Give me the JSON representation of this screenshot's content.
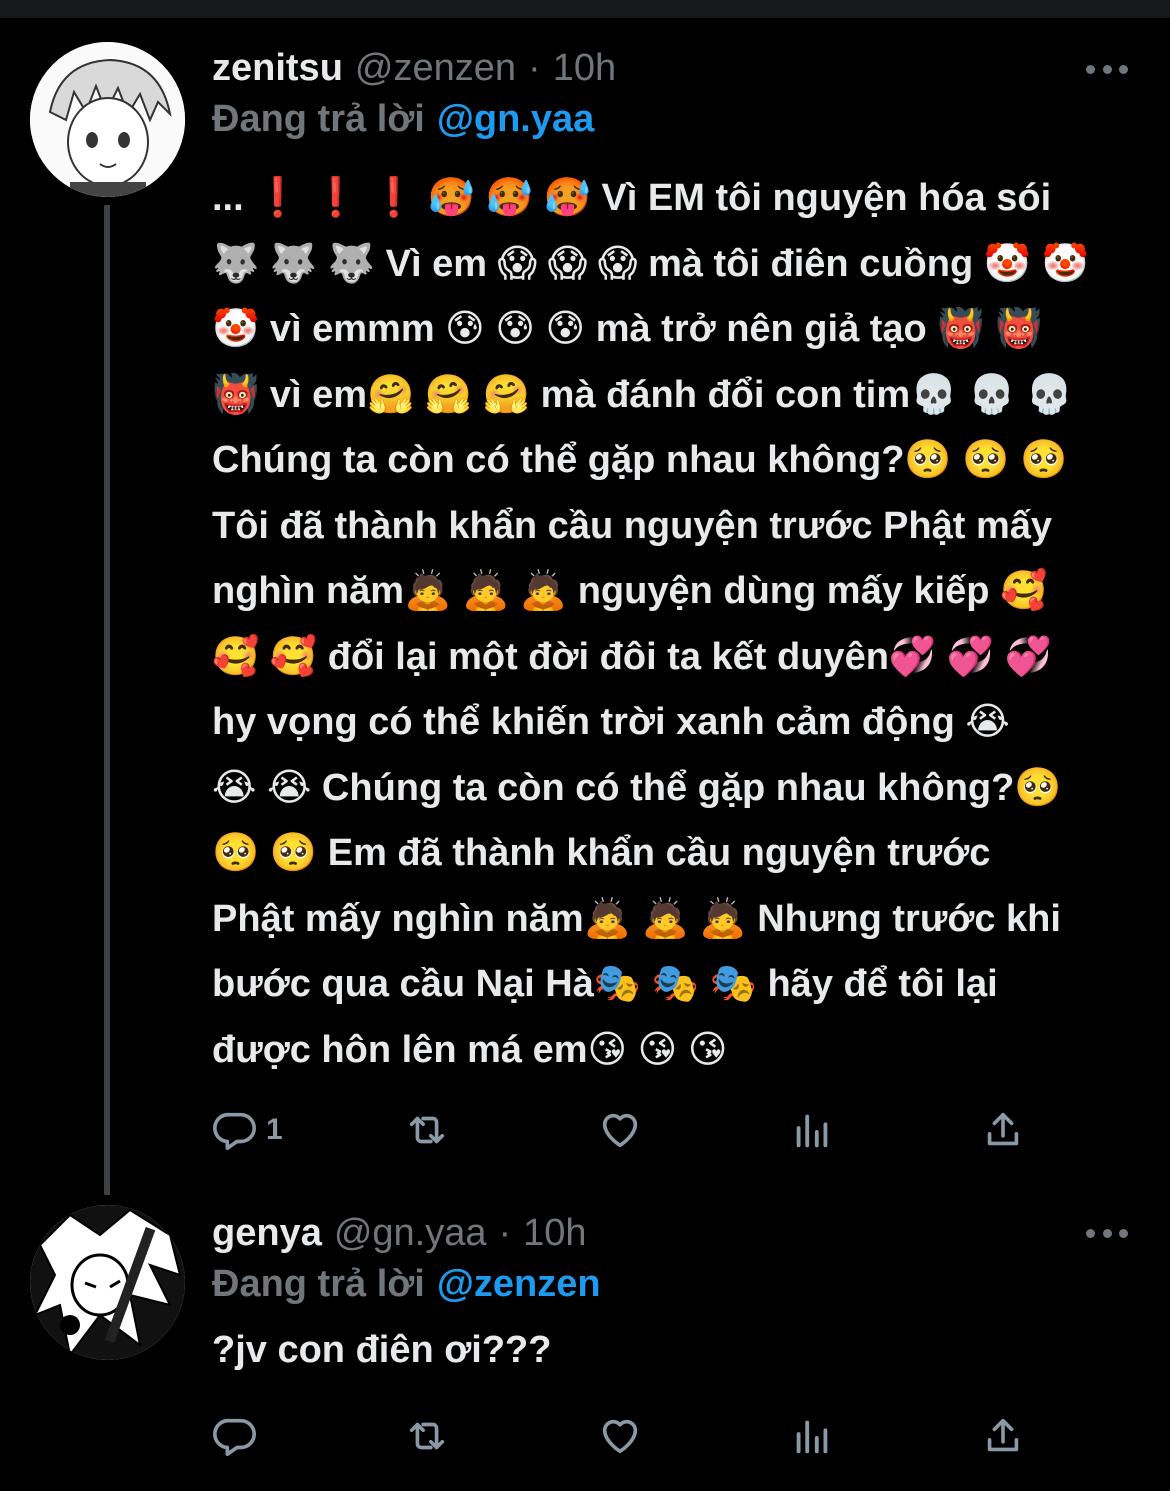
{
  "tweets": [
    {
      "display_name": "zenitsu",
      "handle": "@zenzen",
      "separator": "·",
      "time": "10h",
      "replying_prefix": "Đang trả lời",
      "replying_to": "@gn.yaa",
      "body_lines": [
        "... ❗ ❗ ❗  🥵 🥵 🥵  Vì EM tôi nguyện hóa sói",
        "🐺 🐺 🐺  Vì em 😱 😱 😱 mà tôi điên cuồng 🤡 🤡",
        "🤡  vì emmm 😰 😰 😰  mà trở nên giả tạo 👹 👹",
        "👹  vì em🤗 🤗 🤗  mà đánh đổi con tim💀 💀 💀",
        "Chúng ta còn có thể gặp nhau không?🥺 🥺 🥺",
        "Tôi đã thành khẩn cầu nguyện trước Phật mấy",
        "nghìn năm🙇 🙇 🙇  nguyện dùng mấy kiếp 🥰",
        "🥰 🥰 đổi lại một đời đôi ta kết duyên💞 💞 💞",
        "hy vọng có thể khiến trời xanh cảm động 😭",
        "😭 😭  Chúng ta còn có thể gặp nhau không?🥺",
        "🥺 🥺  Em đã thành khẩn cầu nguyện trước",
        "Phật mấy nghìn năm🙇 🙇 🙇  Nhưng trước khi",
        "bước qua cầu Nại Hà🎭 🎭 🎭  hãy để tôi lại",
        "được hôn lên má em😘 😘 😘"
      ],
      "reply_count": "1"
    },
    {
      "display_name": "genya",
      "handle": "@gn.yaa",
      "separator": "·",
      "time": "10h",
      "replying_prefix": "Đang trả lời",
      "replying_to": "@zenzen",
      "body_lines": [
        "?jv con điên ơi???"
      ],
      "reply_count": ""
    }
  ],
  "icons": {
    "reply": "reply-icon",
    "retweet": "retweet-icon",
    "like": "like-icon",
    "views": "views-icon",
    "share": "share-icon",
    "more": "more-icon"
  },
  "colors": {
    "background": "#000000",
    "text": "#e7e9ea",
    "muted": "#71767b",
    "accent": "#1d9bf0",
    "thread_line": "#3e4144"
  }
}
